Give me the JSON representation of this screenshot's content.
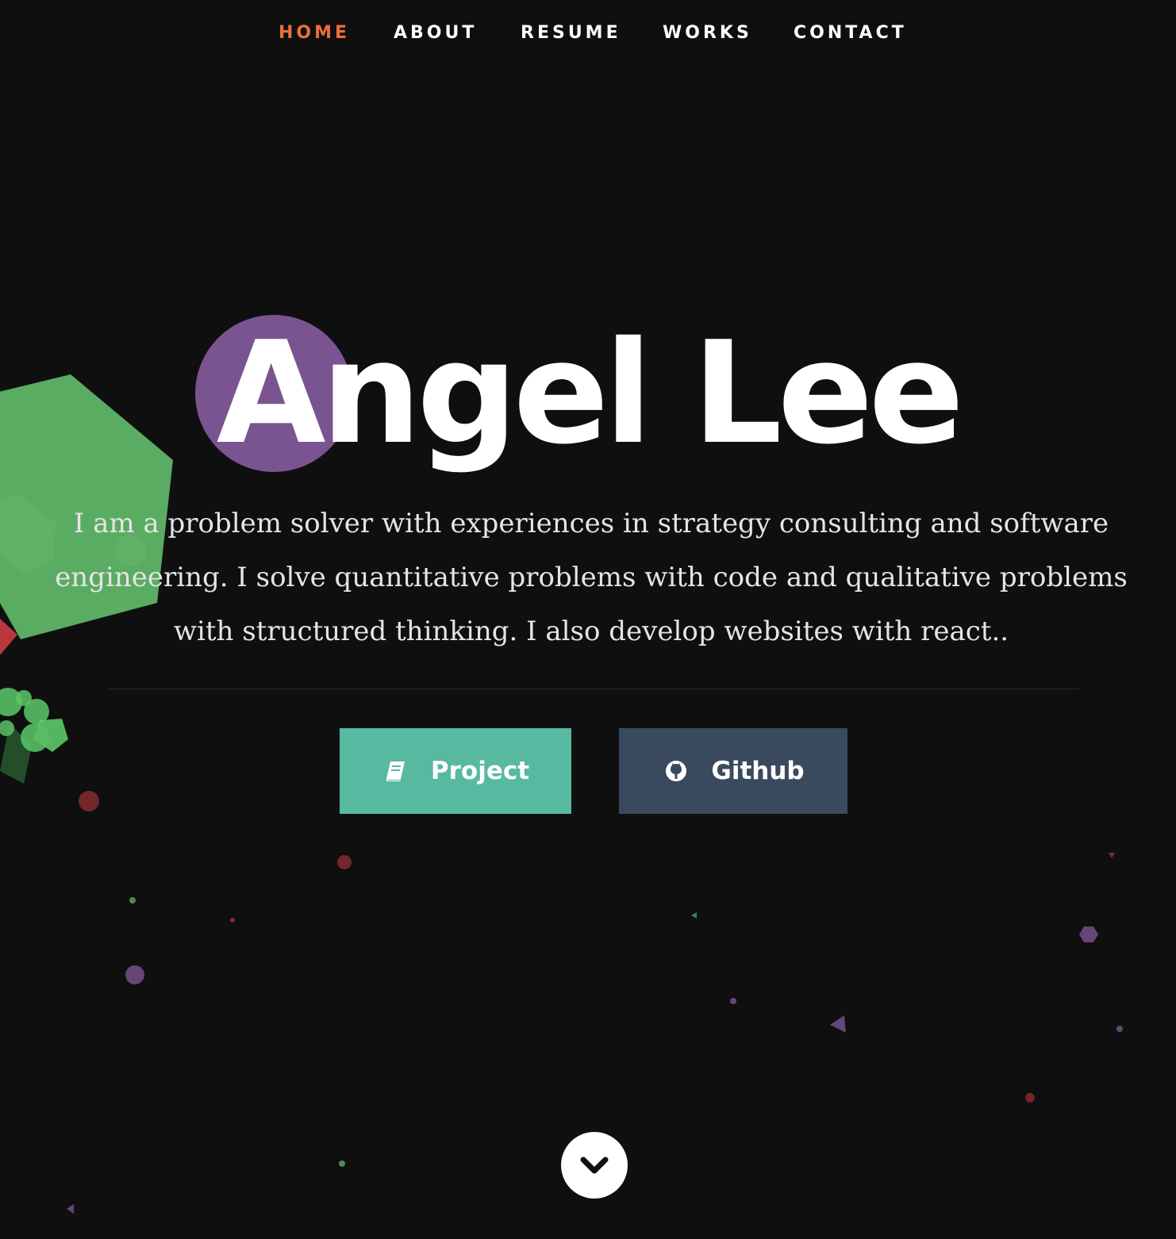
{
  "nav": {
    "items": [
      {
        "label": "HOME",
        "active": true
      },
      {
        "label": "ABOUT",
        "active": false
      },
      {
        "label": "RESUME",
        "active": false
      },
      {
        "label": "WORKS",
        "active": false
      },
      {
        "label": "CONTACT",
        "active": false
      }
    ]
  },
  "hero": {
    "title": "Angel Lee",
    "description": "I am a problem solver with experiences in strategy consulting and software engineering. I solve quantitative problems with code and qualitative problems with structured thinking. I also develop websites with react.."
  },
  "buttons": {
    "project": {
      "label": "Project",
      "icon": "book-icon"
    },
    "github": {
      "label": "Github",
      "icon": "github-icon"
    }
  },
  "scroll": {
    "icon": "chevron-down-icon"
  },
  "colors": {
    "background": "#0f0f10",
    "accent": "#e8703a",
    "project_button": "#57b9a0",
    "github_button": "#3a4a5e",
    "particle_purple": "#7a5490",
    "particle_green": "#5aac62",
    "particle_red": "#b8363e"
  }
}
